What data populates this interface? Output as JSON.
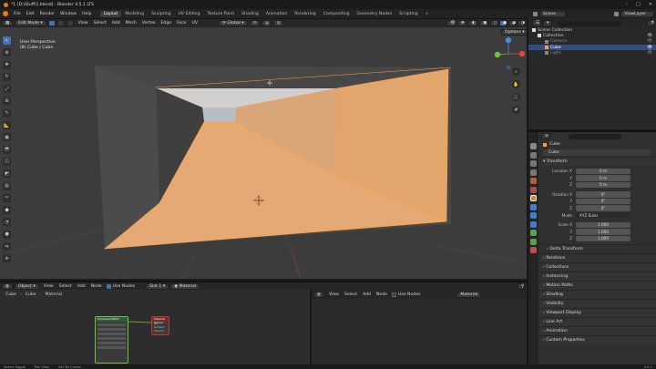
{
  "window": {
    "title": "*1 [D:\\Stuff\\1.blend] - Blender 4.5.1 LTS",
    "controls": [
      "–",
      "□",
      "✕"
    ]
  },
  "menu": [
    "File",
    "Edit",
    "Render",
    "Window",
    "Help"
  ],
  "workspaces": [
    "Layout",
    "Modeling",
    "Sculpting",
    "UV Editing",
    "Texture Paint",
    "Shading",
    "Animation",
    "Rendering",
    "Compositing",
    "Geometry Nodes",
    "Scripting"
  ],
  "active_workspace": "Layout",
  "add_workspace": "+",
  "scene": {
    "label": "Scene",
    "view_layer": "ViewLayer"
  },
  "viewport_header": {
    "mode": "Edit Mode",
    "menus": [
      "View",
      "Select",
      "Add",
      "Mesh",
      "Vertex",
      "Edge",
      "Face",
      "UV"
    ],
    "transform_orientation": "Global",
    "options": "Options"
  },
  "viewport": {
    "perspective_label": "User Perspective",
    "object_label": "(8) Cube | Cube",
    "gizmo_axes": {
      "x": "X",
      "y": "Y",
      "z": "Z"
    }
  },
  "tools": [
    "select",
    "cursor",
    "move",
    "rotate",
    "scale",
    "transform",
    "annotate",
    "measure",
    "add-cube",
    "extrude",
    "inset",
    "bevel",
    "loop-cut",
    "knife",
    "poly-build",
    "spin",
    "smooth",
    "edge-slide",
    "shrink",
    "shear",
    "rip"
  ],
  "node_editor_header": {
    "type": "Object",
    "menus": [
      "View",
      "Select",
      "Add",
      "Node"
    ],
    "use_nodes": "Use Nodes",
    "slot": "Slot 1",
    "material": "Material"
  },
  "breadcrumb": [
    "Cube",
    "Cube",
    "Material"
  ],
  "text_editor_header": {
    "menus": [
      "View",
      "Select",
      "Add",
      "Node"
    ],
    "use_nodes": "Use Nodes",
    "slot": "Material"
  },
  "outliner": {
    "items": [
      {
        "label": "Scene Collection",
        "level": 0
      },
      {
        "label": "Collection",
        "level": 1
      },
      {
        "label": "Camera",
        "level": 2
      },
      {
        "label": "Cube",
        "level": 2,
        "selected": true
      },
      {
        "label": "Light",
        "level": 2
      }
    ]
  },
  "properties": {
    "object_name": "Cube",
    "object_field": "Cube",
    "sections": {
      "transform": "Transform",
      "location": {
        "label": "Location X",
        "x": "0 m",
        "y": "0 m",
        "z": "0 m"
      },
      "rotation": {
        "label": "Rotation X",
        "x": "0°",
        "y": "0°",
        "z": "0°"
      },
      "mode": {
        "label": "Mode",
        "value": "XYZ Euler"
      },
      "scale": {
        "label": "Scale X",
        "x": "1.000",
        "y": "1.000",
        "z": "1.000"
      },
      "axis_y": "Y",
      "axis_z": "Z",
      "delta": "Delta Transform"
    },
    "collapsed_panels": [
      "Relations",
      "Collections",
      "Instancing",
      "Motion Paths",
      "Shading",
      "Visibility",
      "Viewport Display",
      "Line Art",
      "Animation",
      "Custom Properties"
    ]
  },
  "statusbar": {
    "items": [
      "Select Toggle",
      "Pan View",
      "Set 3D Cursor"
    ],
    "version": "4.5.1"
  },
  "nodes": {
    "shader_title": "Principled BSDF",
    "output_title": "Material Output",
    "output_slots": [
      "All",
      "Surface",
      "Volume",
      "Displacement"
    ]
  },
  "colors": {
    "accent": "#4772b3",
    "face_fill": "#e2a56b",
    "selected_edge": "#ffa040"
  }
}
